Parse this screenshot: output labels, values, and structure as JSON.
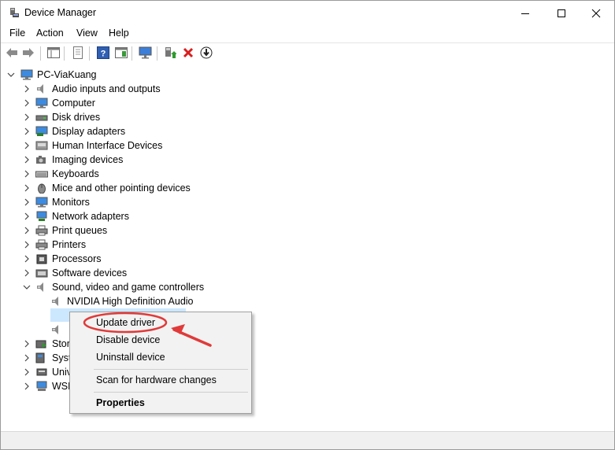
{
  "window": {
    "title": "Device Manager"
  },
  "menu": {
    "file": "File",
    "action": "Action",
    "view": "View",
    "help": "Help"
  },
  "tree": {
    "root": "PC-ViaKuang",
    "categories": [
      {
        "label": "Audio inputs and outputs",
        "icon": "speaker-icon"
      },
      {
        "label": "Computer",
        "icon": "computer-icon"
      },
      {
        "label": "Disk drives",
        "icon": "disk-drive-icon"
      },
      {
        "label": "Display adapters",
        "icon": "display-adapter-icon"
      },
      {
        "label": "Human Interface Devices",
        "icon": "hid-icon"
      },
      {
        "label": "Imaging devices",
        "icon": "camera-icon"
      },
      {
        "label": "Keyboards",
        "icon": "keyboard-icon"
      },
      {
        "label": "Mice and other pointing devices",
        "icon": "mouse-icon"
      },
      {
        "label": "Monitors",
        "icon": "monitor-icon"
      },
      {
        "label": "Network adapters",
        "icon": "network-icon"
      },
      {
        "label": "Print queues",
        "icon": "printer-icon"
      },
      {
        "label": "Printers",
        "icon": "printer-icon"
      },
      {
        "label": "Processors",
        "icon": "processor-icon"
      },
      {
        "label": "Software devices",
        "icon": "software-device-icon"
      },
      {
        "label": "Sound, video and game controllers",
        "icon": "speaker-icon"
      }
    ],
    "sound_children": [
      {
        "label": "NVIDIA High Definition Audio",
        "icon": "speaker-icon"
      }
    ],
    "partial_categories": [
      {
        "label": "Stor",
        "icon": "storage-icon"
      },
      {
        "label": "Syst",
        "icon": "system-icon"
      },
      {
        "label": "Univ",
        "icon": "usb-icon"
      },
      {
        "label": "WSD",
        "icon": "wsd-icon"
      }
    ]
  },
  "context_menu": {
    "update_driver": "Update driver",
    "disable_device": "Disable device",
    "uninstall_device": "Uninstall device",
    "scan_hardware": "Scan for hardware changes",
    "properties": "Properties"
  },
  "colors": {
    "annotation": "#e03a3a",
    "selection": "#cce8ff",
    "menu_bg": "#f2f2f2"
  }
}
